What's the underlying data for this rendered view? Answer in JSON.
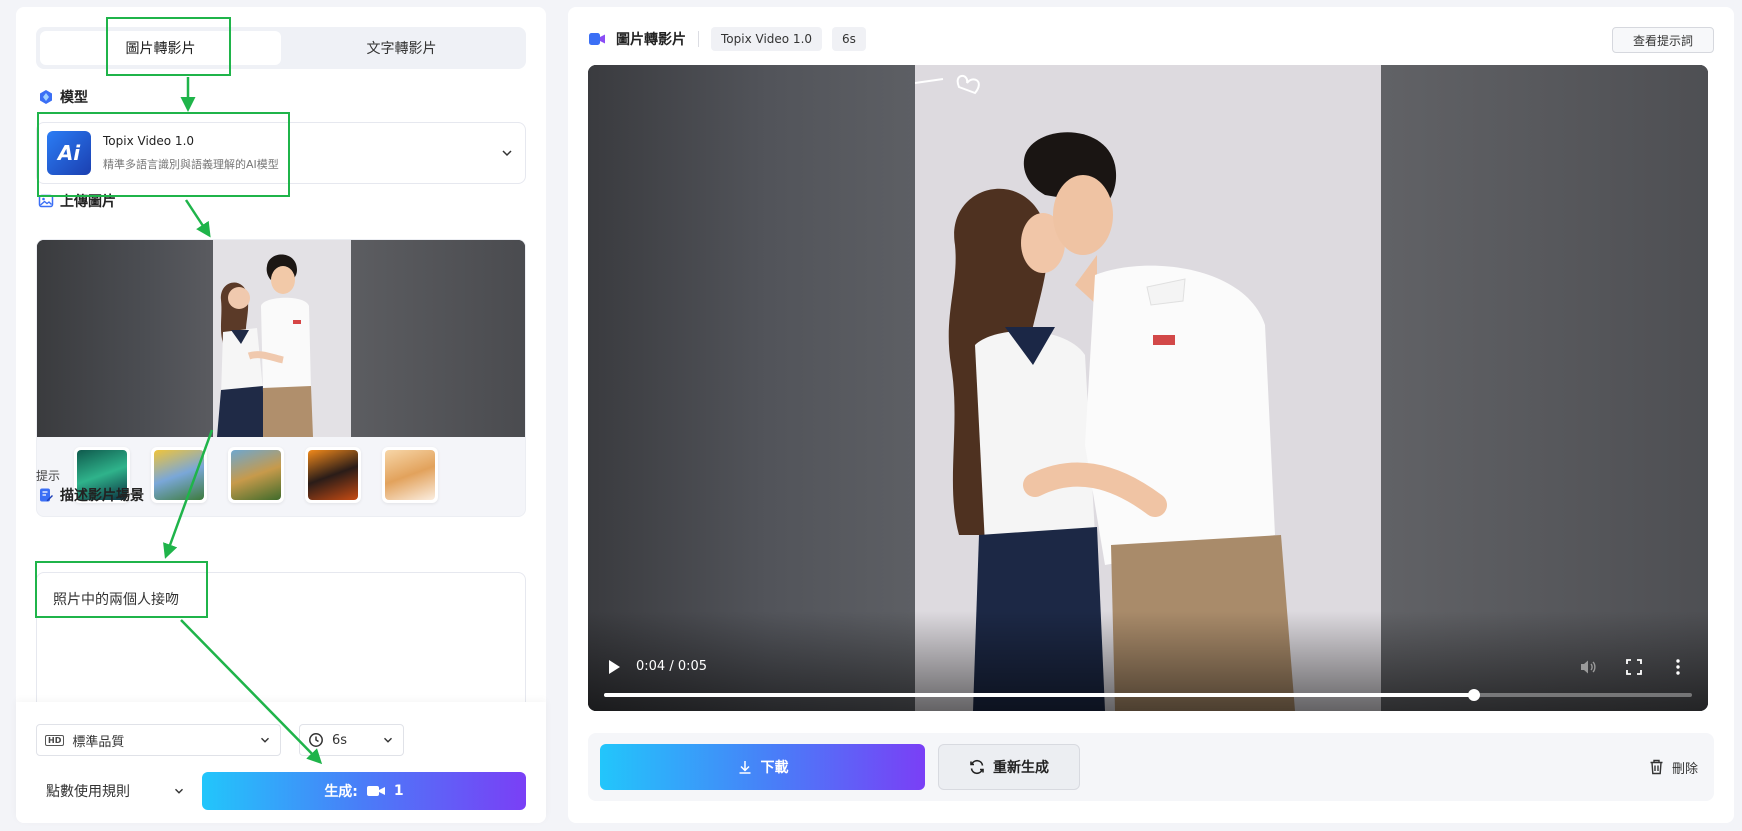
{
  "left": {
    "tabs": [
      {
        "label": "圖片轉影片",
        "active": true
      },
      {
        "label": "文字轉影片",
        "active": false
      }
    ],
    "model": {
      "section_label": "模型",
      "logo_text": "Ai",
      "name": "Topix Video 1.0",
      "description": "精準多語言識別與語義理解的AI模型"
    },
    "upload": {
      "section_label": "上傳圖片",
      "hint_label": "提示",
      "hint_thumbs": [
        {
          "icon": "aurora-thumbnail",
          "colors": [
            "#0f5a4d",
            "#2fb38b",
            "#0b2f3f"
          ]
        },
        {
          "icon": "lego-figure-thumbnail",
          "colors": [
            "#f0c43a",
            "#7aa7d8",
            "#3d7b3c"
          ]
        },
        {
          "icon": "motocross-thumbnail",
          "colors": [
            "#6ea7cf",
            "#c79a4b",
            "#3f6b2b"
          ]
        },
        {
          "icon": "perfume-bottle-thumbnail",
          "colors": [
            "#f28a1b",
            "#2a1c18",
            "#c74b13"
          ]
        },
        {
          "icon": "cat-thumbnail",
          "colors": [
            "#f7d6a8",
            "#e2a25c",
            "#fbeee0"
          ]
        }
      ]
    },
    "describe": {
      "section_label": "描述影片場景",
      "text": "照片中的兩個人接吻"
    },
    "bottom": {
      "quality_badge": "HD",
      "quality": "標準品質",
      "duration": "6s",
      "points_rule": "點數使用規則",
      "generate_label": "生成:",
      "generate_cost": "1"
    }
  },
  "right": {
    "title": "圖片轉影片",
    "model_tag": "Topix Video 1.0",
    "duration_tag": "6s",
    "prompt_button": "查看提示詞",
    "video": {
      "time": "0:04 / 0:05",
      "progress": 0.8
    },
    "download_label": "下載",
    "regenerate_label": "重新生成",
    "delete_label": "刪除"
  },
  "colors": {
    "annotation": "#1fb44a",
    "gradient_start": "#22c6fb",
    "gradient_end": "#7a3ff6"
  }
}
